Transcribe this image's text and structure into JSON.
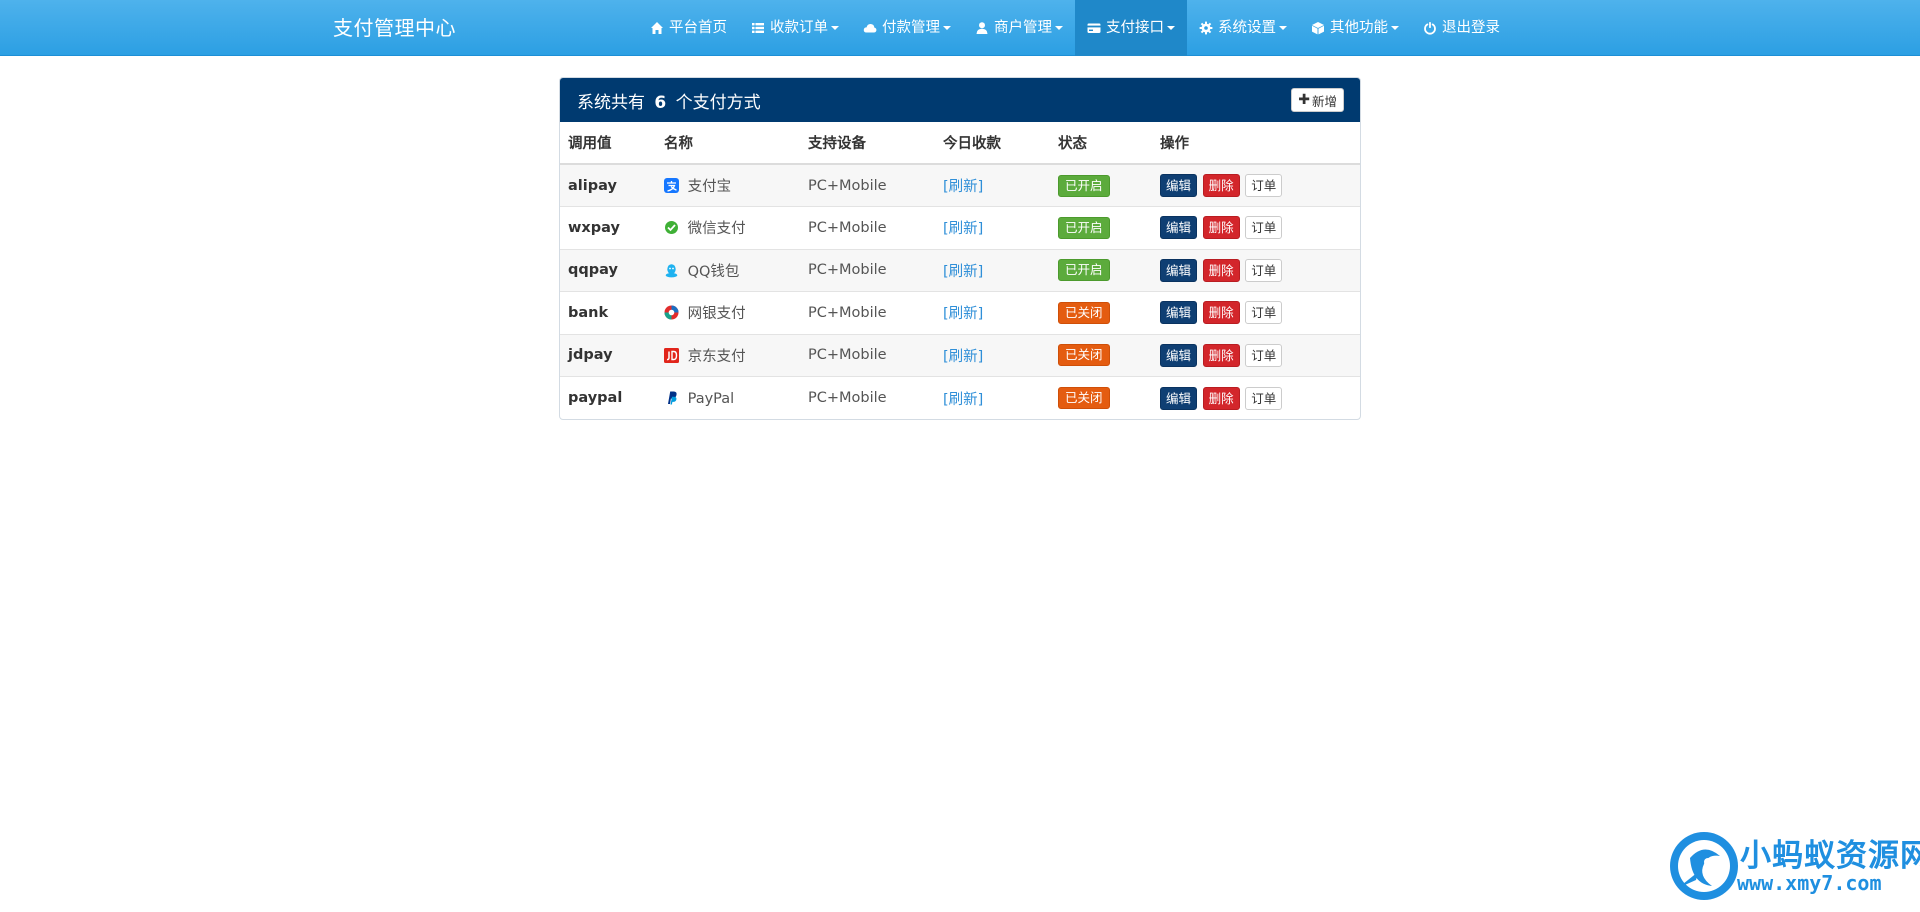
{
  "app": {
    "brand": "支付管理中心"
  },
  "nav": [
    {
      "label": "平台首页",
      "icon": "home-icon",
      "dropdown": false,
      "active": false
    },
    {
      "label": "收款订单",
      "icon": "list-icon",
      "dropdown": true,
      "active": false
    },
    {
      "label": "付款管理",
      "icon": "cloud-icon",
      "dropdown": true,
      "active": false
    },
    {
      "label": "商户管理",
      "icon": "user-icon",
      "dropdown": true,
      "active": false
    },
    {
      "label": "支付接口",
      "icon": "credit-card-icon",
      "dropdown": true,
      "active": true
    },
    {
      "label": "系统设置",
      "icon": "gear-icon",
      "dropdown": true,
      "active": false
    },
    {
      "label": "其他功能",
      "icon": "cube-icon",
      "dropdown": true,
      "active": false
    },
    {
      "label": "退出登录",
      "icon": "power-icon",
      "dropdown": false,
      "active": false
    }
  ],
  "panel": {
    "title_prefix": "系统共有",
    "count": "6",
    "title_suffix": "个支付方式",
    "add_label": "新增"
  },
  "table": {
    "headers": [
      "调用值",
      "名称",
      "支持设备",
      "今日收款",
      "状态",
      "操作"
    ],
    "rows": [
      {
        "code": "alipay",
        "name": "支付宝",
        "icon": "alipay-icon",
        "device": "PC+Mobile",
        "today": "[刷新]",
        "status": "已开启",
        "on": true
      },
      {
        "code": "wxpay",
        "name": "微信支付",
        "icon": "wechat-pay-icon",
        "device": "PC+Mobile",
        "today": "[刷新]",
        "status": "已开启",
        "on": true
      },
      {
        "code": "qqpay",
        "name": "QQ钱包",
        "icon": "qq-wallet-icon",
        "device": "PC+Mobile",
        "today": "[刷新]",
        "status": "已开启",
        "on": true
      },
      {
        "code": "bank",
        "name": "网银支付",
        "icon": "unionpay-icon",
        "device": "PC+Mobile",
        "today": "[刷新]",
        "status": "已关闭",
        "on": false
      },
      {
        "code": "jdpay",
        "name": "京东支付",
        "icon": "jd-icon",
        "device": "PC+Mobile",
        "today": "[刷新]",
        "status": "已关闭",
        "on": false
      },
      {
        "code": "paypal",
        "name": "PayPal",
        "icon": "paypal-icon",
        "device": "PC+Mobile",
        "today": "[刷新]",
        "status": "已关闭",
        "on": false
      }
    ],
    "actions": {
      "edit": "编辑",
      "delete": "删除",
      "order": "订单"
    }
  },
  "watermark": {
    "title": "小蚂蚁资源网",
    "url": "www.xmy7.com"
  },
  "colors": {
    "navbar": "#2c9fe3",
    "panel_heading": "#003a70",
    "status_on": "#5cab3c",
    "status_off": "#e45c10",
    "edit": "#0f3f73",
    "delete": "#d3262b",
    "link": "#2f8fd8"
  }
}
